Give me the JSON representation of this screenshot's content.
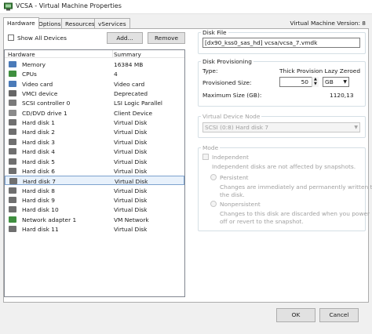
{
  "window": {
    "title": "VCSA - Virtual Machine Properties"
  },
  "tabs": [
    {
      "label": "Hardware"
    },
    {
      "label": "Options"
    },
    {
      "label": "Resources"
    },
    {
      "label": "vServices"
    }
  ],
  "vm_version": "Virtual Machine Version: 8",
  "hardware_panel": {
    "show_all_devices_label": "Show All Devices",
    "add_label": "Add...",
    "remove_label": "Remove",
    "columns": [
      "Hardware",
      "Summary"
    ],
    "rows": [
      {
        "name": "Memory",
        "summary": "16384 MB",
        "icon": "memory-icon"
      },
      {
        "name": "CPUs",
        "summary": "4",
        "icon": "cpu-icon"
      },
      {
        "name": "Video card",
        "summary": "Video card",
        "icon": "video-card-icon"
      },
      {
        "name": "VMCI device",
        "summary": "Deprecated",
        "icon": "vmci-device-icon"
      },
      {
        "name": "SCSI controller 0",
        "summary": "LSI Logic Parallel",
        "icon": "scsi-controller-icon"
      },
      {
        "name": "CD/DVD drive 1",
        "summary": "Client Device",
        "icon": "cd-dvd-drive-icon"
      },
      {
        "name": "Hard disk 1",
        "summary": "Virtual Disk",
        "icon": "hard-disk-icon"
      },
      {
        "name": "Hard disk 2",
        "summary": "Virtual Disk",
        "icon": "hard-disk-icon"
      },
      {
        "name": "Hard disk 3",
        "summary": "Virtual Disk",
        "icon": "hard-disk-icon"
      },
      {
        "name": "Hard disk 4",
        "summary": "Virtual Disk",
        "icon": "hard-disk-icon"
      },
      {
        "name": "Hard disk 5",
        "summary": "Virtual Disk",
        "icon": "hard-disk-icon"
      },
      {
        "name": "Hard disk 6",
        "summary": "Virtual Disk",
        "icon": "hard-disk-icon"
      },
      {
        "name": "Hard disk 7",
        "summary": "Virtual Disk",
        "icon": "hard-disk-icon",
        "selected": true
      },
      {
        "name": "Hard disk 8",
        "summary": "Virtual Disk",
        "icon": "hard-disk-icon"
      },
      {
        "name": "Hard disk 9",
        "summary": "Virtual Disk",
        "icon": "hard-disk-icon"
      },
      {
        "name": "Hard disk 10",
        "summary": "Virtual Disk",
        "icon": "hard-disk-icon"
      },
      {
        "name": "Network adapter 1",
        "summary": "VM Network",
        "icon": "network-adapter-icon"
      },
      {
        "name": "Hard disk 11",
        "summary": "Virtual Disk",
        "icon": "hard-disk-icon"
      }
    ]
  },
  "disk_file": {
    "title": "Disk File",
    "value": "[dx90_kss0_sas_hd] vcsa/vcsa_7.vmdk"
  },
  "disk_provisioning": {
    "title": "Disk Provisioning",
    "type_label": "Type:",
    "type_value": "Thick Provision Lazy Zeroed",
    "size_label": "Provisioned Size:",
    "size_value": "50",
    "size_unit": "GB",
    "max_label": "Maximum Size (GB):",
    "max_value": "1120,13"
  },
  "virtual_device_node": {
    "title": "Virtual Device Node",
    "value": "SCSI (0:8) Hard disk 7"
  },
  "mode": {
    "title": "Mode",
    "independent_label": "Independent",
    "independent_desc": "Independent disks are not affected by snapshots.",
    "persistent_label": "Persistent",
    "persistent_desc_1": "Changes are immediately and permanently written to",
    "persistent_desc_2": "the disk.",
    "nonpersistent_label": "Nonpersistent",
    "nonpersistent_desc_1": "Changes to this disk are discarded when you power",
    "nonpersistent_desc_2": "off or revert to the snapshot."
  },
  "footer": {
    "ok_label": "OK",
    "cancel_label": "Cancel"
  },
  "colors": {
    "selection_bg": "#e8f1fb",
    "selection_border": "#7da2ce"
  }
}
